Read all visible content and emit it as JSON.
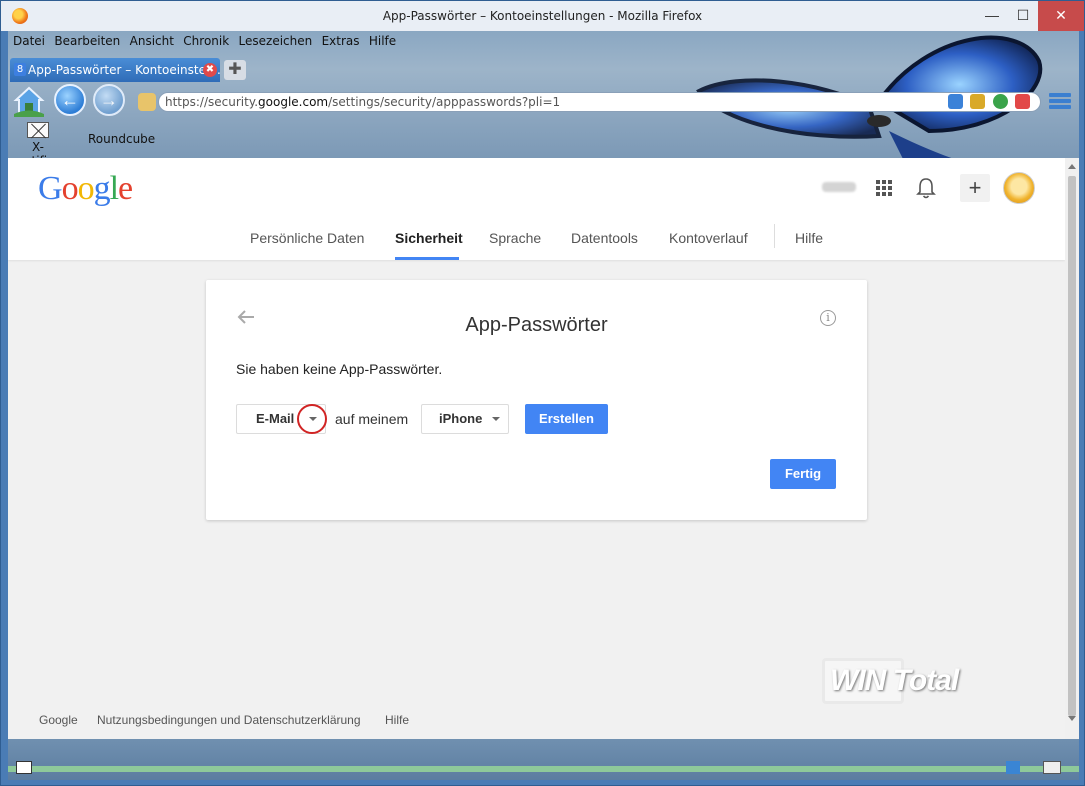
{
  "window": {
    "title": "App-Passwörter – Kontoeinstellungen - Mozilla Firefox",
    "min_symbol": "—",
    "max_symbol": "☐",
    "close_symbol": "✕"
  },
  "menu": {
    "items": [
      "Datei",
      "Bearbeiten",
      "Ansicht",
      "Chronik",
      "Lesezeichen",
      "Extras",
      "Hilfe"
    ]
  },
  "tab": {
    "label": "App-Passwörter – Kontoeinstel...",
    "favicon_letter": "8",
    "newtab_symbol": "✚",
    "close_symbol": "✖"
  },
  "nav": {
    "back_symbol": "←",
    "forward_symbol": "→",
    "url_prefix": "https://security.",
    "url_domain": "google.com",
    "url_suffix": "/settings/security/apppasswords?pli=1"
  },
  "bookmarks": {
    "xnotifier": "X-notifier",
    "roundcube": "Roundcube"
  },
  "google": {
    "logo": [
      "G",
      "o",
      "o",
      "g",
      "l",
      "e"
    ],
    "plus_symbol": "+",
    "nav": [
      "Persönliche Daten",
      "Sicherheit",
      "Sprache",
      "Datentools",
      "Kontoverlauf",
      "Hilfe"
    ],
    "active_tab": "Sicherheit"
  },
  "card": {
    "title": "App-Passwörter",
    "info_symbol": "i",
    "message": "Sie haben keine App-Passwörter.",
    "app_select": "E-Mail",
    "connector": "auf meinem",
    "device_select": "iPhone",
    "create_button": "Erstellen",
    "done_button": "Fertig"
  },
  "watermark": "WIN Total",
  "footer": {
    "google": "Google",
    "terms": "Nutzungsbedingungen und Datenschutzerklärung",
    "help": "Hilfe"
  },
  "colors": {
    "accent": "#4285f4",
    "annotation_circle": "#d12424"
  }
}
